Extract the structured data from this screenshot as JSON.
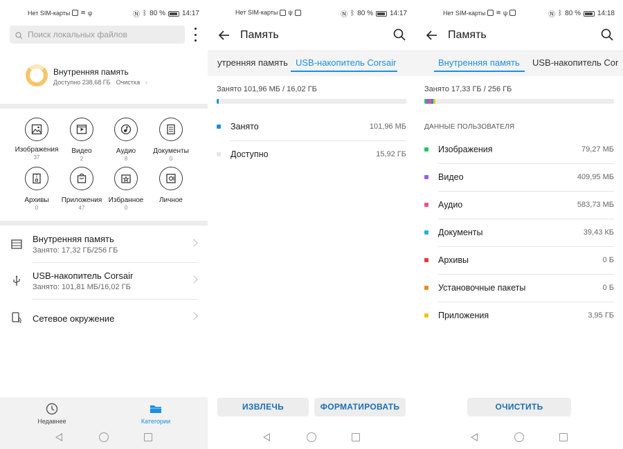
{
  "status": {
    "sim": "Нет SIM-карты",
    "battery": "80 %",
    "time_1": "14:17",
    "time_2": "14:17",
    "time_3": "14:18"
  },
  "screen1": {
    "search_placeholder": "Поиск локальных файлов",
    "internal": {
      "title": "Внутренняя память",
      "available": "Доступно 238,68 ГБ",
      "clean": "Очистка"
    },
    "categories": [
      {
        "label": "Изображения",
        "count": "37",
        "icon": "image-icon"
      },
      {
        "label": "Видео",
        "count": "2",
        "icon": "video-icon"
      },
      {
        "label": "Аудио",
        "count": "8",
        "icon": "audio-icon"
      },
      {
        "label": "Документы",
        "count": "0",
        "icon": "document-icon"
      },
      {
        "label": "Архивы",
        "count": "0",
        "icon": "archive-icon"
      },
      {
        "label": "Приложения",
        "count": "47",
        "icon": "app-icon"
      },
      {
        "label": "Избранное",
        "count": "0",
        "icon": "favorite-icon"
      },
      {
        "label": "Личное",
        "count": "",
        "icon": "safe-icon"
      }
    ],
    "storage": [
      {
        "title": "Внутренняя память",
        "sub": "Занято: 17,32 ГБ/256 ГБ",
        "icon": "storage-icon"
      },
      {
        "title": "USB-накопитель Corsair",
        "sub": "Занято: 101,81 МБ/16,02 ГБ",
        "icon": "usb-icon"
      },
      {
        "title": "Сетевое окружение",
        "sub": "",
        "icon": "network-icon"
      }
    ],
    "bottom_nav": {
      "recent": "Недавнее",
      "categories": "Категории"
    }
  },
  "screen2": {
    "title": "Память",
    "tab_internal": "утренняя память",
    "tab_usb": "USB-накопитель Corsair",
    "used_label": "Занято 101,96 МБ / 16,02 ГБ",
    "usage_fraction": 0.0064,
    "rows": [
      {
        "label": "Занято",
        "value": "101,96 МБ",
        "color": "#1a8fe3"
      },
      {
        "label": "Доступно",
        "value": "15,92 ГБ",
        "color": "#e6e6e6"
      }
    ],
    "eject": "ИЗВЛЕЧЬ",
    "format": "ФОРМАТИРОВАТЬ"
  },
  "screen3": {
    "title": "Память",
    "tab_internal": "Внутренняя память",
    "tab_usb": "USB-накопитель Cor",
    "used_label": "Занято 17,33 ГБ / 256 ГБ",
    "section": "ДАННЫЕ ПОЛЬЗОВАТЕЛЯ",
    "rows": [
      {
        "label": "Изображения",
        "value": "79,27 МБ",
        "color": "#22c55e"
      },
      {
        "label": "Видео",
        "value": "409,95 МБ",
        "color": "#9b5de5"
      },
      {
        "label": "Аудио",
        "value": "583,73 МБ",
        "color": "#f0508c"
      },
      {
        "label": "Документы",
        "value": "39,43 КБ",
        "color": "#1fb6d9"
      },
      {
        "label": "Архивы",
        "value": "0 Б",
        "color": "#e83a3a"
      },
      {
        "label": "Установочные пакеты",
        "value": "0 Б",
        "color": "#f08a1c"
      },
      {
        "label": "Приложения",
        "value": "3,95 ГБ",
        "color": "#f5c518"
      }
    ],
    "clean": "ОЧИСТИТЬ"
  },
  "colors": {
    "accent": "#1a8fe3",
    "button_text": "#1a6fb3"
  }
}
